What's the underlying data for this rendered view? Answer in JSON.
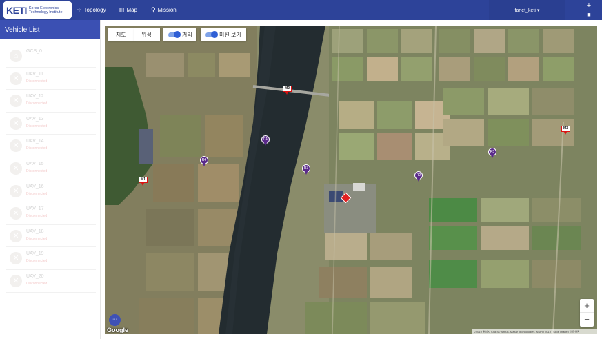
{
  "topbar": {
    "logo_mark": "KETI",
    "logo_text_1": "Korea Electronics",
    "logo_text_2": "Technology Institute",
    "nav": [
      {
        "label": "Topology",
        "icon": "topology-icon"
      },
      {
        "label": "Map",
        "icon": "map-icon"
      },
      {
        "label": "Mission",
        "icon": "location-pin-icon"
      }
    ],
    "user": "fanet_keti ▾",
    "add_icon": "+",
    "trash_icon": "🗑"
  },
  "sidebar": {
    "title": "Vehicle List",
    "vehicles": [
      {
        "name": "GCS_0",
        "status": "",
        "icon": "home-icon"
      },
      {
        "name": "UAV_11",
        "status": "Disconnected",
        "icon": "uav-icon"
      },
      {
        "name": "UAV_12",
        "status": "Disconnected",
        "icon": "uav-icon"
      },
      {
        "name": "UAV_13",
        "status": "Disconnected",
        "icon": "uav-icon"
      },
      {
        "name": "UAV_14",
        "status": "Disconnected",
        "icon": "uav-icon"
      },
      {
        "name": "UAV_15",
        "status": "Disconnected",
        "icon": "uav-icon"
      },
      {
        "name": "UAV_16",
        "status": "Disconnected",
        "icon": "uav-icon"
      },
      {
        "name": "UAV_17",
        "status": "Disconnected",
        "icon": "uav-icon"
      },
      {
        "name": "UAV_18",
        "status": "Disconnected",
        "icon": "uav-icon"
      },
      {
        "name": "UAV_19",
        "status": "Disconnected",
        "icon": "uav-icon"
      },
      {
        "name": "UAV_20",
        "status": "Disconnected",
        "icon": "uav-icon"
      }
    ]
  },
  "map": {
    "type_map": "지도",
    "type_satellite": "위성",
    "toggle_distance": "거리",
    "toggle_mission": "미션 보기",
    "markers": {
      "R1": "R1",
      "R2": "R2",
      "R3": "R3",
      "R4": "R4",
      "R5": "R5",
      "M1": "M1",
      "M2": "M2",
      "M3": "M3"
    },
    "zoom_in": "+",
    "zoom_out": "−",
    "fab": "···",
    "google": "Google",
    "attribution": "©2019 위성지 CNES / Airbus, Maxar Technologies, NSPO 2019 / Spot Image  |  이용약관"
  },
  "colors": {
    "topbar": "#2d4399",
    "sidebar_header": "#3b50b3",
    "waypoint": "#5a2a8a",
    "mission_flag": "#dd1111"
  }
}
